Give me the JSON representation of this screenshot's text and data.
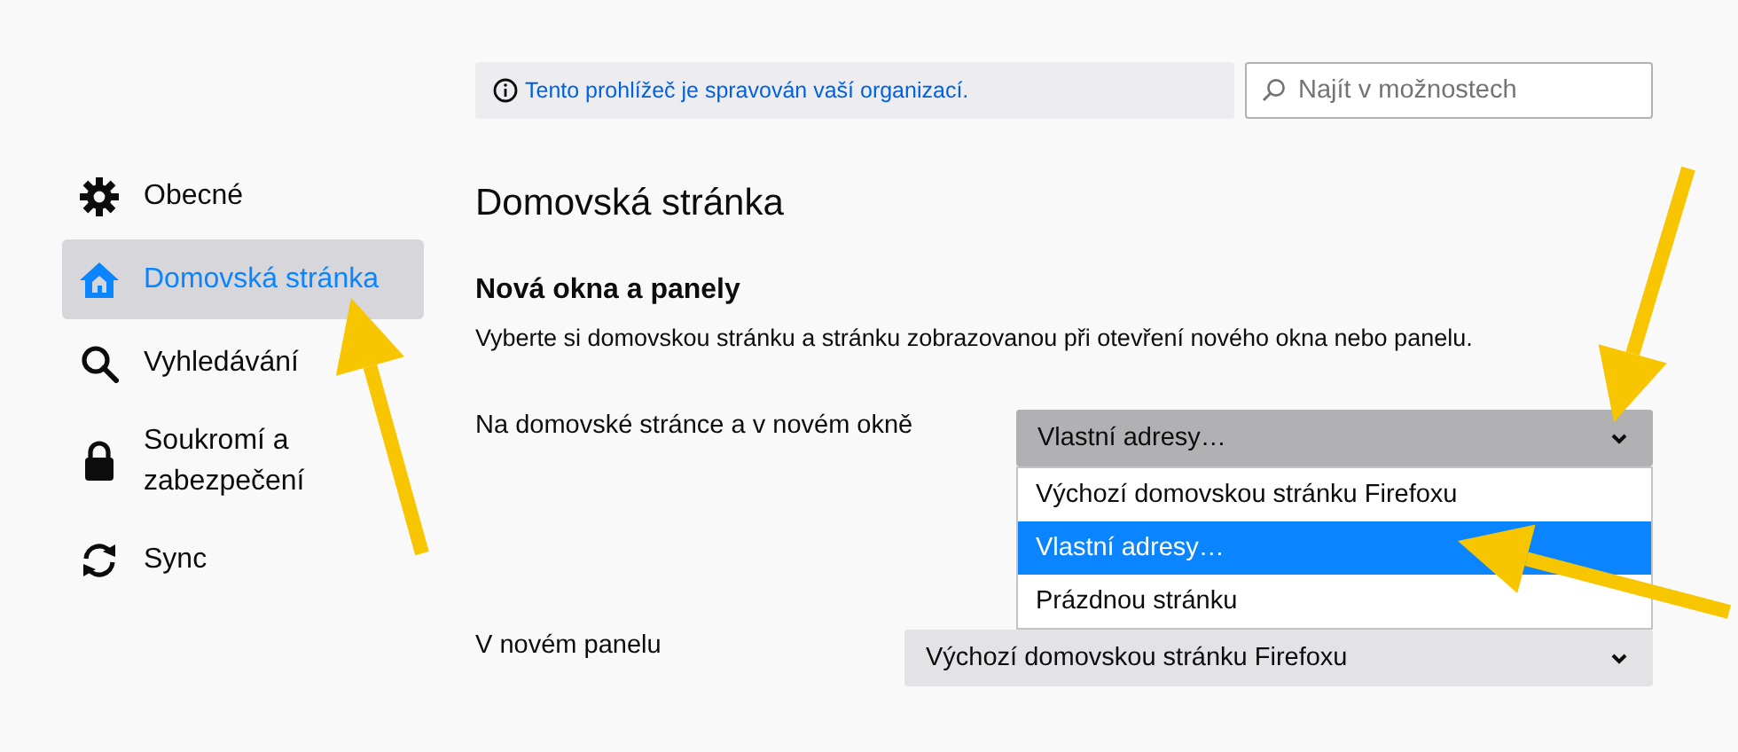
{
  "sidebar": {
    "items": [
      {
        "label": "Obecné",
        "selected": false
      },
      {
        "label": "Domovská stránka",
        "selected": true
      },
      {
        "label": "Vyhledávání",
        "selected": false
      },
      {
        "label": "Soukromí a zabezpečení",
        "selected": false
      },
      {
        "label": "Sync",
        "selected": false
      }
    ]
  },
  "notice": {
    "text": "Tento prohlížeč je spravován vaší organizací."
  },
  "search": {
    "placeholder": "Najít v možnostech"
  },
  "page_title": "Domovská stránka",
  "section": {
    "title": "Nová okna a panely",
    "description": "Vyberte si domovskou stránku a stránku zobrazovanou při otevření nového okna nebo panelu.",
    "settings": [
      {
        "label": "Na domovské stránce a v novém okně",
        "value": "Vlastní adresy…",
        "expanded": true,
        "options": [
          {
            "label": "Výchozí domovskou stránku Firefoxu",
            "selected": false
          },
          {
            "label": "Vlastní adresy…",
            "selected": true
          },
          {
            "label": "Prázdnou stránku",
            "selected": false
          }
        ]
      },
      {
        "label": "V novém panelu",
        "value": "Výchozí domovskou stránku Firefoxu",
        "expanded": false
      }
    ]
  }
}
